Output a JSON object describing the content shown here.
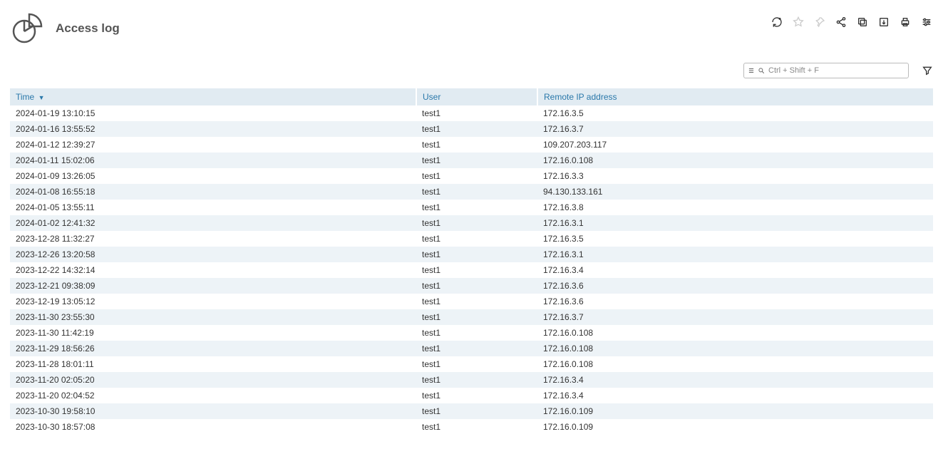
{
  "header": {
    "title": "Access log"
  },
  "toolbar": {
    "refresh": "refresh",
    "favorite": "favorite",
    "pin": "pin",
    "share": "share",
    "copy": "copy",
    "export": "export",
    "print": "print",
    "settings": "settings"
  },
  "search": {
    "placeholder": "Ctrl + Shift + F",
    "value": ""
  },
  "columns": {
    "time": "Time",
    "user": "User",
    "ip": "Remote IP address"
  },
  "rows": [
    {
      "time": "2024-01-19 13:10:15",
      "user": "test1",
      "ip": "172.16.3.5"
    },
    {
      "time": "2024-01-16 13:55:52",
      "user": "test1",
      "ip": "172.16.3.7"
    },
    {
      "time": "2024-01-12 12:39:27",
      "user": "test1",
      "ip": "109.207.203.117"
    },
    {
      "time": "2024-01-11 15:02:06",
      "user": "test1",
      "ip": "172.16.0.108"
    },
    {
      "time": "2024-01-09 13:26:05",
      "user": "test1",
      "ip": "172.16.3.3"
    },
    {
      "time": "2024-01-08 16:55:18",
      "user": "test1",
      "ip": "94.130.133.161"
    },
    {
      "time": "2024-01-05 13:55:11",
      "user": "test1",
      "ip": "172.16.3.8"
    },
    {
      "time": "2024-01-02 12:41:32",
      "user": "test1",
      "ip": "172.16.3.1"
    },
    {
      "time": "2023-12-28 11:32:27",
      "user": "test1",
      "ip": "172.16.3.5"
    },
    {
      "time": "2023-12-26 13:20:58",
      "user": "test1",
      "ip": "172.16.3.1"
    },
    {
      "time": "2023-12-22 14:32:14",
      "user": "test1",
      "ip": "172.16.3.4"
    },
    {
      "time": "2023-12-21 09:38:09",
      "user": "test1",
      "ip": "172.16.3.6"
    },
    {
      "time": "2023-12-19 13:05:12",
      "user": "test1",
      "ip": "172.16.3.6"
    },
    {
      "time": "2023-11-30 23:55:30",
      "user": "test1",
      "ip": "172.16.3.7"
    },
    {
      "time": "2023-11-30 11:42:19",
      "user": "test1",
      "ip": "172.16.0.108"
    },
    {
      "time": "2023-11-29 18:56:26",
      "user": "test1",
      "ip": "172.16.0.108"
    },
    {
      "time": "2023-11-28 18:01:11",
      "user": "test1",
      "ip": "172.16.0.108"
    },
    {
      "time": "2023-11-20 02:05:20",
      "user": "test1",
      "ip": "172.16.3.4"
    },
    {
      "time": "2023-11-20 02:04:52",
      "user": "test1",
      "ip": "172.16.3.4"
    },
    {
      "time": "2023-10-30 19:58:10",
      "user": "test1",
      "ip": "172.16.0.109"
    },
    {
      "time": "2023-10-30 18:57:08",
      "user": "test1",
      "ip": "172.16.0.109"
    }
  ]
}
